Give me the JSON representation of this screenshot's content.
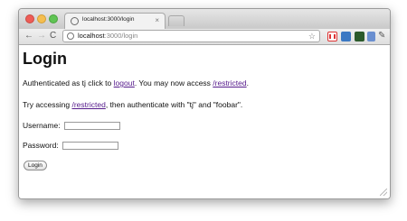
{
  "browser": {
    "tab": {
      "title": "localhost:3000/login",
      "close": "×"
    },
    "nav": {
      "back": "←",
      "forward": "→",
      "reload": "C"
    },
    "address": {
      "host": "localhost",
      "path": ":3000/login"
    },
    "star": "☆",
    "wrench": "✎",
    "extensions": [
      "gmail-extension-icon",
      "extension-2-icon",
      "extension-3-icon",
      "extension-4-icon"
    ]
  },
  "page": {
    "title": "Login",
    "line1": {
      "before": "Authenticated as tj click to ",
      "link": "logout",
      "middle": ". You may now access ",
      "link2": "/restricted",
      "after": "."
    },
    "line2": {
      "before": "Try accessing ",
      "link": "/restricted",
      "after": ", then authenticate with \"tj\" and \"foobar\"."
    },
    "form": {
      "username_label": "Username:",
      "username_value": "",
      "password_label": "Password:",
      "password_value": "",
      "submit_label": "Login"
    }
  },
  "colors": {
    "link": "#551a8b",
    "close": "#ee5c56",
    "minimize": "#f5be4f",
    "maximize": "#60c454"
  }
}
